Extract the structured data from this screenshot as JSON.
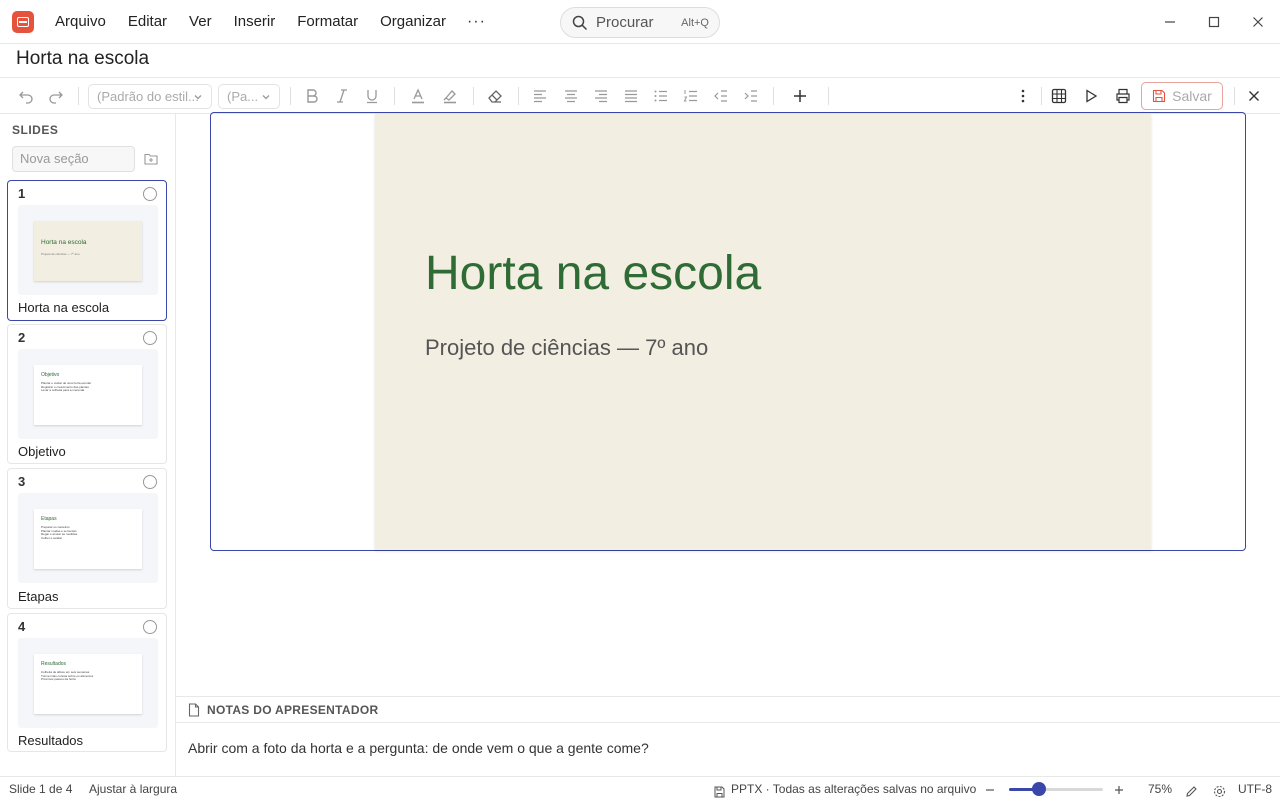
{
  "menu": {
    "items": [
      "Arquivo",
      "Editar",
      "Ver",
      "Inserir",
      "Formatar",
      "Organizar"
    ],
    "more": "···"
  },
  "search": {
    "placeholder": "Procurar",
    "shortcut": "Alt+Q"
  },
  "document": {
    "title": "Horta na escola"
  },
  "toolbar": {
    "style_select": "(Padrão do estil...",
    "size_select": "(Pa...",
    "save_label": "Salvar"
  },
  "sidebar": {
    "title": "SLIDES",
    "section_placeholder": "Nova seção",
    "slides": [
      {
        "number": "1",
        "label": "Horta na escola",
        "thumb_title": "Horta na escola",
        "thumb_sub": "Projeto de ciências — 7º ano",
        "thumb_lines": []
      },
      {
        "number": "2",
        "label": "Objetivo",
        "thumb_title": "Objetivo",
        "thumb_sub": "",
        "thumb_lines": [
          "Plantar e cuidar de uma horta escolar",
          "Registrar o crescimento das plantas",
          "Levar a colheita para a merenda"
        ]
      },
      {
        "number": "3",
        "label": "Etapas",
        "thumb_title": "Etapas",
        "thumb_sub": "",
        "thumb_lines": [
          "Preparar os canteiros",
          "Plantar mudas e sementes",
          "Regar e anotar as medidas",
          "Colher e avaliar"
        ]
      },
      {
        "number": "4",
        "label": "Resultados",
        "thumb_title": "Resultados",
        "thumb_sub": "",
        "thumb_lines": [
          "Colheita de alface em seis semanas",
          "Turma mais curiosa sobre os alimentos",
          "Próximos passos da horta"
        ]
      }
    ]
  },
  "slide": {
    "title": "Horta na escola",
    "subtitle": "Projeto de ciências — 7º ano",
    "background": "#f3eee2",
    "title_color": "#2e6b35"
  },
  "notes": {
    "title": "NOTAS DO APRESENTADOR",
    "text": "Abrir com a foto da horta e a pergunta: de onde vem o que a gente come?"
  },
  "status": {
    "slide_position": "Slide 1 de 4",
    "fit": "Ajustar à largura",
    "file_state": "PPTX · Todas as alterações salvas no arquivo",
    "zoom_label": "75%",
    "zoom_fraction": 0.32,
    "encoding": "UTF-8"
  },
  "colors": {
    "accent": "#3a46a8",
    "brand": "#e5533d",
    "save_border": "#e6a39b"
  }
}
